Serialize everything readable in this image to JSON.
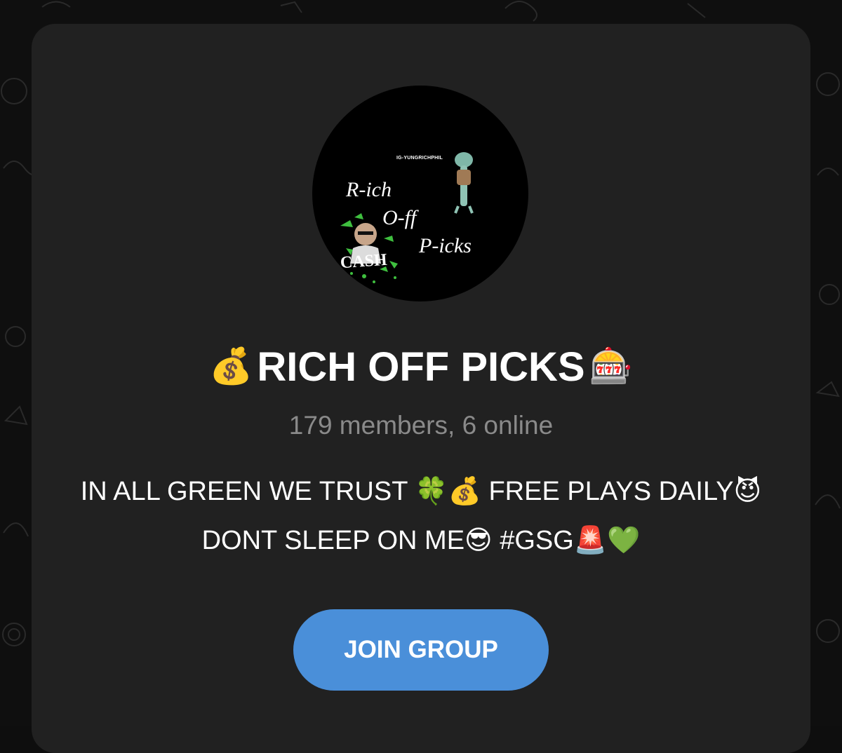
{
  "group": {
    "avatar": {
      "handle": "IG-YUNGRICHPHIL",
      "line1": "R-ich",
      "line2": "O-ff",
      "line3": "P-icks",
      "badge": "CASH"
    },
    "title_prefix_emoji": "💰",
    "title": "RICH OFF PICKS",
    "title_suffix_emoji": "🎰",
    "members_status": "179 members, 6 online",
    "description": "IN ALL GREEN WE TRUST 🍀💰 FREE PLAYS DAILY😈 DONT SLEEP ON ME😎 #GSG🚨💚",
    "join_button_label": "JOIN GROUP"
  },
  "colors": {
    "background": "#0f0f0f",
    "card": "#212121",
    "accent": "#4a8fd9",
    "muted_text": "#8a8a8a"
  }
}
